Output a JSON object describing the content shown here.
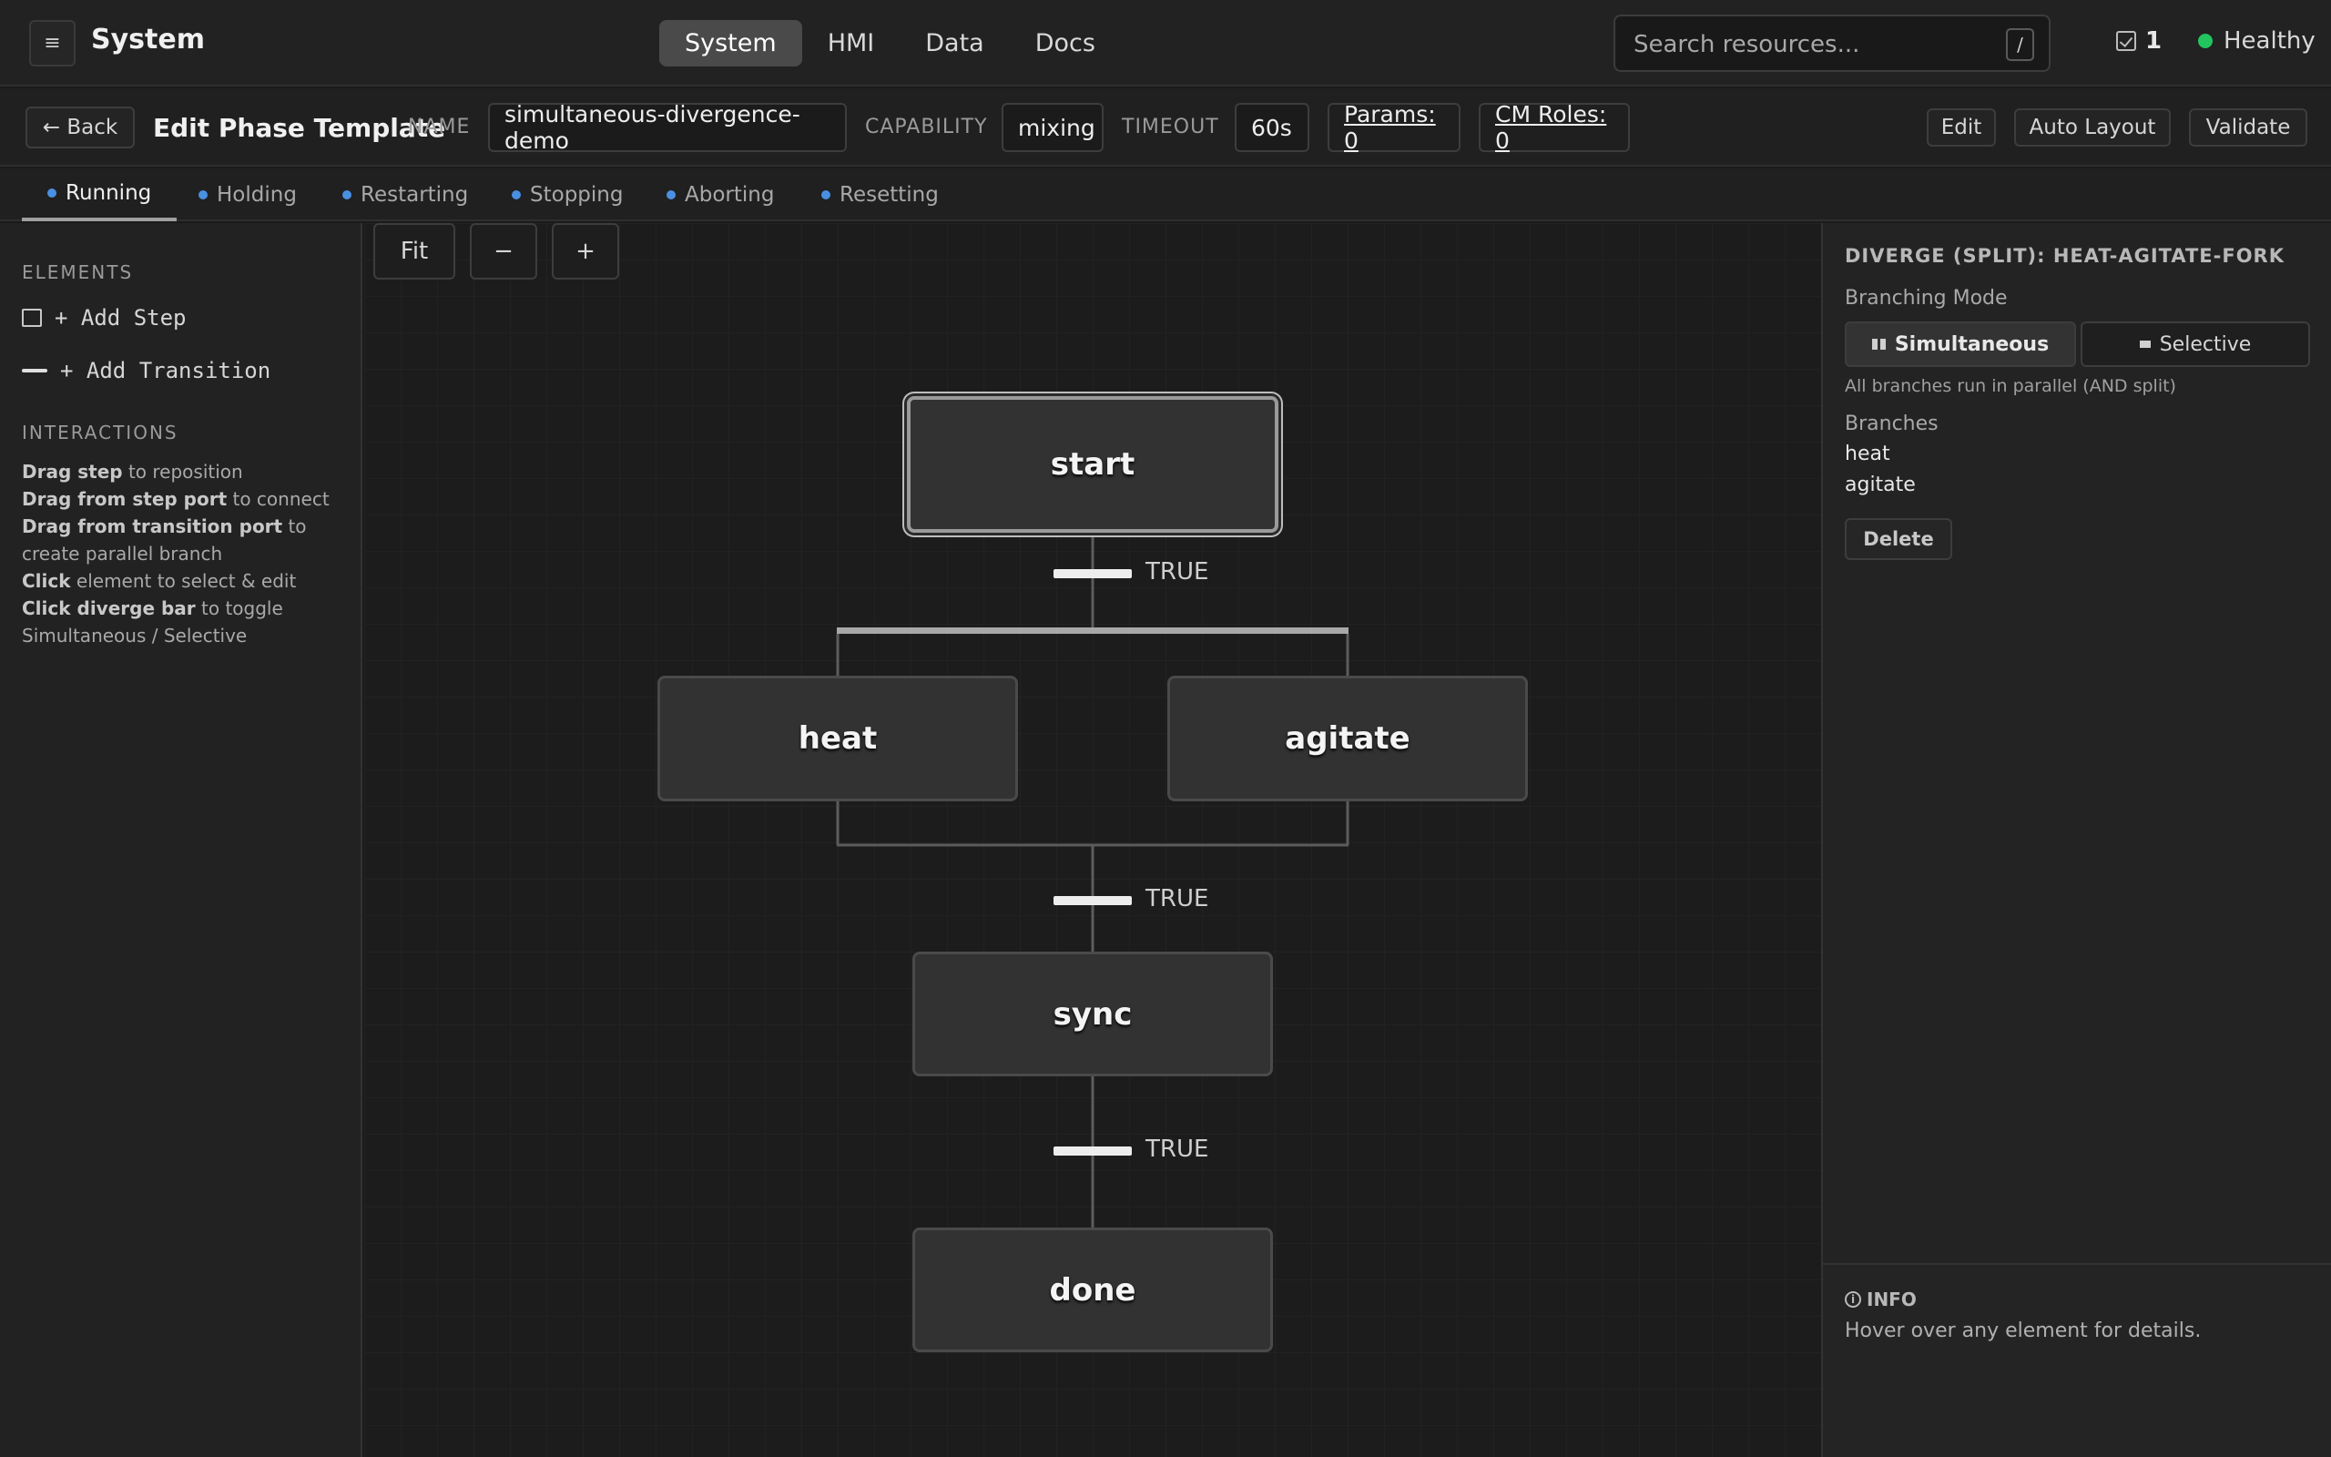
{
  "topbar": {
    "menu_icon": "≡",
    "title": "System",
    "nav": [
      "System",
      "HMI",
      "Data",
      "Docs"
    ],
    "search_placeholder": "Search resources...",
    "search_shortcut": "/",
    "notification_count": "1",
    "health": "Healthy",
    "health_color": "#22c55e"
  },
  "header": {
    "back_label": "← Back",
    "page_title": "Edit Phase Template",
    "name_label": "NAME",
    "name_value": "simultaneous-divergence-demo",
    "capability_label": "CAPABILITY",
    "capability_value": "mixing",
    "timeout_label": "TIMEOUT",
    "timeout_value": "60s",
    "params_link": "Params: 0",
    "cm_roles_link": "CM Roles: 0",
    "edit_label": "Edit",
    "auto_layout_label": "Auto Layout",
    "validate_label": "Validate"
  },
  "tabs": [
    "Running",
    "Holding",
    "Restarting",
    "Stopping",
    "Aborting",
    "Resetting"
  ],
  "tab_dot_color": "#4a90e2",
  "sidebar": {
    "elements_title": "ELEMENTS",
    "add_step": "+ Add Step",
    "add_transition": "+ Add Transition",
    "interactions_title": "INTERACTIONS",
    "hints": [
      {
        "bold": "Drag step",
        "rest": " to reposition"
      },
      {
        "bold": "Drag from step port",
        "rest": " to connect"
      },
      {
        "bold": "Drag from transition port",
        "rest": " to create parallel branch"
      },
      {
        "bold": "Click",
        "rest": " element to select & edit"
      },
      {
        "bold": "Click diverge bar",
        "rest": " to toggle Simultaneous / Selective"
      }
    ]
  },
  "canvas": {
    "fit_label": "Fit",
    "zoom_out_label": "−",
    "zoom_in_label": "+",
    "steps": [
      "start",
      "heat",
      "agitate",
      "sync",
      "done"
    ],
    "transitions": [
      "TRUE",
      "TRUE",
      "TRUE"
    ]
  },
  "panel": {
    "title": "DIVERGE (SPLIT): HEAT-AGITATE-FORK",
    "branching_mode_label": "Branching Mode",
    "mode_simultaneous": "Simultaneous",
    "mode_selective": "Selective",
    "mode_description": "All branches run in parallel (AND split)",
    "branches_label": "Branches",
    "branches": [
      "heat",
      "agitate"
    ],
    "delete_label": "Delete",
    "info_title": "INFO",
    "info_text": "Hover over any element for details."
  }
}
